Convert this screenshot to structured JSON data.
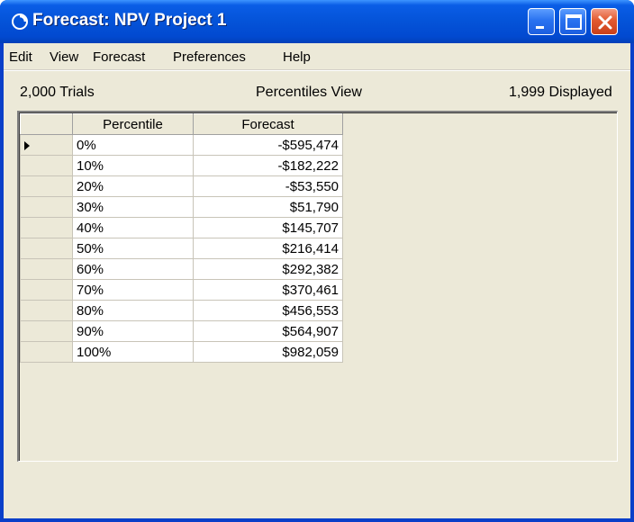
{
  "window": {
    "title": "Forecast: NPV Project 1",
    "icon": "crystal-ball-icon",
    "controls": [
      "minimize-icon",
      "maximize-icon",
      "close-icon"
    ],
    "colors": {
      "titlebar": "#0453d8",
      "client": "#ece9d8",
      "close": "#e2592f"
    }
  },
  "menu": {
    "items": [
      {
        "label": "Edit"
      },
      {
        "label": "View"
      },
      {
        "label": "Forecast"
      },
      {
        "label": "Preferences"
      },
      {
        "label": "Help"
      }
    ]
  },
  "status": {
    "trials": "2,000 Trials",
    "view": "Percentiles View",
    "displayed": "1,999 Displayed"
  },
  "grid": {
    "columns": [
      "Percentile",
      "Forecast"
    ],
    "rows": [
      {
        "percentile": "0%",
        "forecast": "-$595,474"
      },
      {
        "percentile": "10%",
        "forecast": "-$182,222"
      },
      {
        "percentile": "20%",
        "forecast": "-$53,550"
      },
      {
        "percentile": "30%",
        "forecast": "$51,790"
      },
      {
        "percentile": "40%",
        "forecast": "$145,707"
      },
      {
        "percentile": "50%",
        "forecast": "$216,414"
      },
      {
        "percentile": "60%",
        "forecast": "$292,382"
      },
      {
        "percentile": "70%",
        "forecast": "$370,461"
      },
      {
        "percentile": "80%",
        "forecast": "$456,553"
      },
      {
        "percentile": "90%",
        "forecast": "$564,907"
      },
      {
        "percentile": "100%",
        "forecast": "$982,059"
      }
    ],
    "current_row_indicator": "row-pointer-icon"
  }
}
